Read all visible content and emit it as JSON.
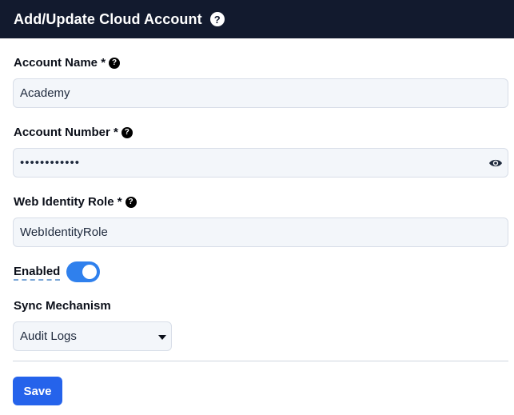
{
  "header": {
    "title": "Add/Update Cloud Account",
    "help_glyph": "?"
  },
  "account_name": {
    "label": "Account Name *",
    "help_glyph": "?",
    "value": "Academy"
  },
  "account_number": {
    "label": "Account Number *",
    "help_glyph": "?",
    "value": "••••••••••••",
    "reveal_icon": "eye-icon"
  },
  "web_identity_role": {
    "label": "Web Identity Role *",
    "help_glyph": "?",
    "value": "WebIdentityRole"
  },
  "enabled": {
    "label": "Enabled",
    "on": true,
    "accent": "#2f80ed"
  },
  "sync_mechanism": {
    "label": "Sync Mechanism",
    "selected": "Audit Logs"
  },
  "actions": {
    "save_label": "Save",
    "save_color": "#2563eb"
  },
  "colors": {
    "header_bg": "#121a2e",
    "input_bg": "#f3f6fa"
  }
}
